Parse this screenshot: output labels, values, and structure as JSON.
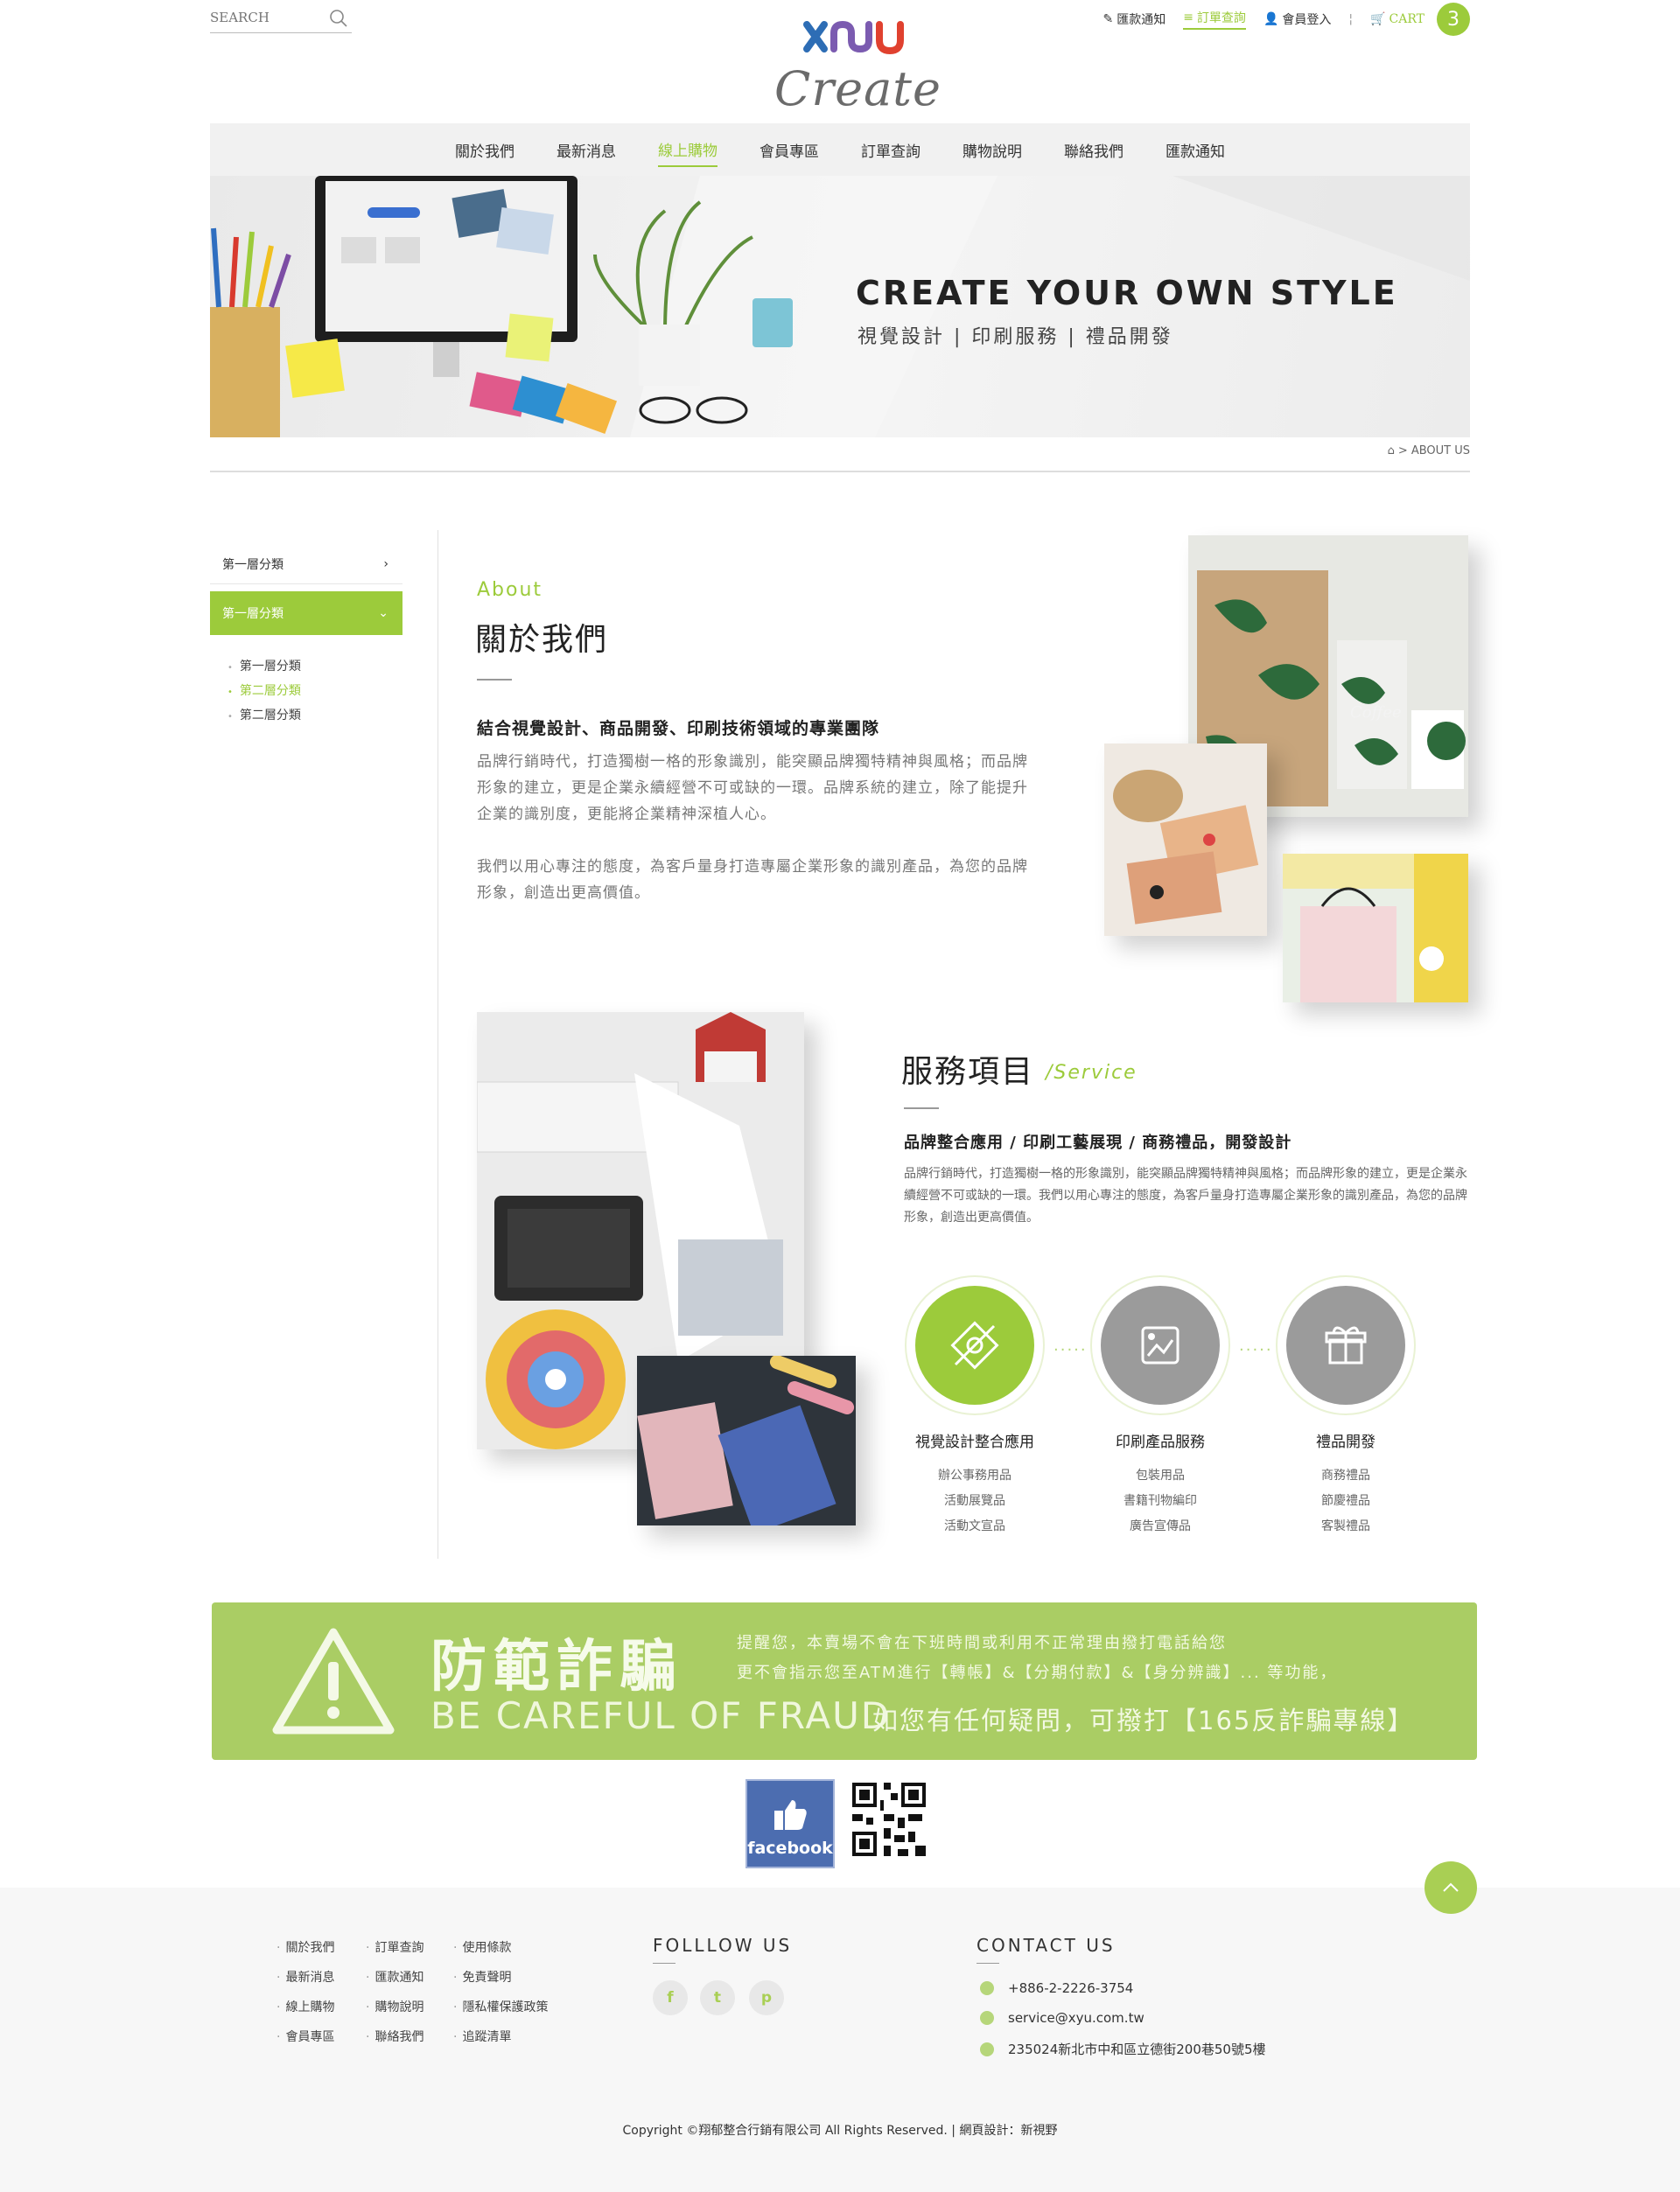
{
  "header": {
    "search_placeholder": "SEARCH",
    "logo_text": "Create",
    "top_links": [
      {
        "label": "匯款通知"
      },
      {
        "label": "訂單查詢"
      },
      {
        "label": "會員登入"
      }
    ],
    "cart_label": "CART",
    "cart_count": "3"
  },
  "nav": {
    "items": [
      {
        "label": "關於我們"
      },
      {
        "label": "最新消息"
      },
      {
        "label": "線上購物"
      },
      {
        "label": "會員專區"
      },
      {
        "label": "訂單查詢"
      },
      {
        "label": "購物說明"
      },
      {
        "label": "聯絡我們"
      },
      {
        "label": "匯款通知"
      }
    ],
    "active_index": 2
  },
  "banner": {
    "title": "CREATE YOUR OWN STYLE",
    "subtitle": "視覺設計 | 印刷服務 | 禮品開發"
  },
  "breadcrumb": {
    "current": "ABOUT US"
  },
  "sidebar": {
    "items": [
      {
        "label": "第一層分類"
      },
      {
        "label": "第一層分類"
      }
    ],
    "sub_items": [
      {
        "label": "第一層分類"
      },
      {
        "label": "第二層分類"
      },
      {
        "label": "第二層分類"
      }
    ]
  },
  "about": {
    "en": "About",
    "title": "關於我們",
    "heading": "結合視覺設計、商品開發、印刷技術領域的專業團隊",
    "p1": "品牌行銷時代，打造獨樹一格的形象識別，能突顯品牌獨特精神與風格；而品牌形象的建立，更是企業永續經營不可或缺的一環。品牌系統的建立，除了能提升企業的識別度，更能將企業精神深植人心。",
    "p2": "我們以用心專注的態度，為客戶量身打造專屬企業形象的識別產品，為您的品牌形象，創造出更高價值。"
  },
  "service": {
    "title": "服務項目",
    "en": "/Service",
    "heading": "品牌整合應用 / 印刷工藝展現 / 商務禮品，開發設計",
    "p": "品牌行銷時代，打造獨樹一格的形象識別，能突顯品牌獨特精神與風格；而品牌形象的建立，更是企業永續經營不可或缺的一環。我們以用心專注的態度，為客戶量身打造專屬企業形象的識別產品，為您的品牌形象，創造出更高價值。",
    "columns": [
      {
        "title": "視覺設計整合應用",
        "items": [
          "辦公事務用品",
          "活動展覽品",
          "活動文宣品"
        ]
      },
      {
        "title": "印刷產品服務",
        "items": [
          "包裝用品",
          "書籍刊物編印",
          "廣告宣傳品"
        ]
      },
      {
        "title": "禮品開發",
        "items": [
          "商務禮品",
          "節慶禮品",
          "客製禮品"
        ]
      }
    ]
  },
  "fraud": {
    "zh": "防範詐騙",
    "en": "BE CAREFUL OF FRAUD",
    "line1": "提醒您，本賣場不會在下班時間或利用不正常理由撥打電話給您",
    "line2": "更不會指示您至ATM進行【轉帳】&【分期付款】&【身分辨識】... 等功能，",
    "line3": "如您有任何疑問，可撥打【165反詐騙專線】"
  },
  "social_badge": {
    "facebook_label": "facebook"
  },
  "footer": {
    "col1": [
      "關於我們",
      "最新消息",
      "線上購物",
      "會員專區"
    ],
    "col2": [
      "訂單查詢",
      "匯款通知",
      "購物說明",
      "聯絡我們"
    ],
    "col3": [
      "使用條款",
      "免責聲明",
      "隱私權保護政策",
      "追蹤清單"
    ],
    "follow_title": "FOLLLOW US",
    "social": [
      "f",
      "t",
      "p"
    ],
    "contact_title": "CONTACT US",
    "phone": "+886-2-2226-3754",
    "email": "service@xyu.com.tw",
    "address": "235024新北市中和區立德街200巷50號5樓",
    "copyright": "Copyright ©翔郁整合行銷有限公司  All Rights Reserved.  |  網頁設計：新視野"
  },
  "colors": {
    "accent": "#9ccb3b",
    "fraud_bg": "#aacd64",
    "grey_circle": "#9b9b9b"
  }
}
